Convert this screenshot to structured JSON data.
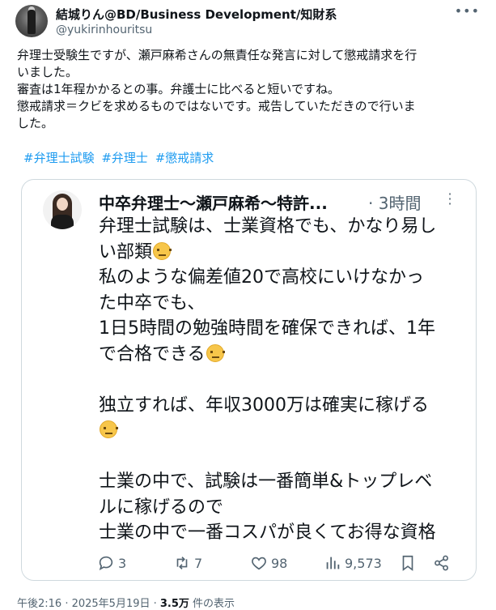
{
  "author": {
    "name": "結城りん@BD/Business Development/知財系",
    "handle": "@yukirinhouritsu"
  },
  "post": {
    "lines": [
      "弁理士受験生ですが、瀬戸麻希さんの無責任な発言に対して懲戒請求を行",
      "いました。",
      "審査は1年程かかるとの事。弁護士に比べると短いですね。",
      "懲戒請求＝クビを求めるものではないです。戒告していただきので行いま",
      "した。"
    ],
    "hashtags": [
      "#弁理士試験",
      "#弁理士",
      "#懲戒請求"
    ]
  },
  "quote": {
    "name": "中卒弁理士〜瀬戸麻希〜特許...",
    "time": "· 3時間",
    "lines": [
      {
        "text": "弁理士試験は、士業資格でも、かなり易し",
        "emoji": false
      },
      {
        "text": "い部類",
        "emoji": true
      },
      {
        "text": "私のような偏差値20で高校にいけなかっ",
        "emoji": false
      },
      {
        "text": "た中卒でも、",
        "emoji": false
      },
      {
        "text": "1日5時間の勉強時間を確保できれば、1年",
        "emoji": false
      },
      {
        "text": "で合格できる",
        "emoji": true
      },
      {
        "text": "",
        "emoji": false
      },
      {
        "text": "独立すれば、年収3000万は確実に稼げる",
        "emoji": false
      },
      {
        "text": "",
        "emoji": true
      },
      {
        "text": "",
        "emoji": false
      },
      {
        "text": "士業の中で、試験は一番簡単&トップレベ",
        "emoji": false
      },
      {
        "text": "ルに稼げるので",
        "emoji": false
      },
      {
        "text": "士業の中で一番コスパが良くてお得な資格",
        "emoji": false
      }
    ]
  },
  "actions": {
    "replies": "3",
    "reposts": "7",
    "likes": "98",
    "views": "9,573"
  },
  "meta": {
    "timestamp": "午後2:16 · 2025年5月19日 · ",
    "views_count": "3.5万",
    "views_label": " 件の表示"
  },
  "icons": [
    "more-icon",
    "reply-icon",
    "repost-icon",
    "like-icon",
    "views-icon",
    "bookmark-icon",
    "share-icon"
  ],
  "colors": {
    "text": "#0f1419",
    "secondary": "#536471",
    "link": "#1d9bf0",
    "border": "#cfd9de"
  }
}
